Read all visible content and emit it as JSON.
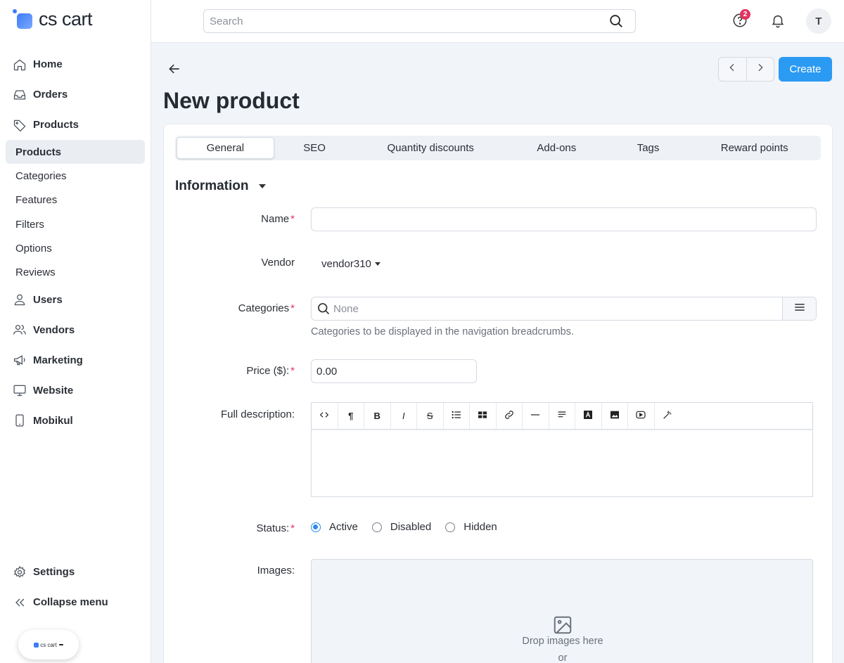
{
  "app": {
    "logo_text": "cs cart",
    "badge_text": "cs cart",
    "badge_tag": ""
  },
  "search": {
    "placeholder": "Search"
  },
  "header": {
    "notifications_count": "2",
    "avatar_initial": "T"
  },
  "sidebar": {
    "items": [
      {
        "label": "Home",
        "icon": "home-icon"
      },
      {
        "label": "Orders",
        "icon": "inbox-icon"
      },
      {
        "label": "Products",
        "icon": "tag-icon"
      }
    ],
    "sub_items": [
      "Products",
      "Categories",
      "Features",
      "Filters",
      "Options",
      "Reviews"
    ],
    "items_after": [
      {
        "label": "Users",
        "icon": "user-icon"
      },
      {
        "label": "Vendors",
        "icon": "users-icon"
      },
      {
        "label": "Marketing",
        "icon": "megaphone-icon"
      },
      {
        "label": "Website",
        "icon": "monitor-icon"
      },
      {
        "label": "Mobikul",
        "icon": "phone-icon"
      }
    ],
    "settings_label": "Settings",
    "collapse_label": "Collapse menu"
  },
  "page": {
    "title": "New product",
    "create_label": "Create"
  },
  "tabs": [
    "General",
    "SEO",
    "Quantity discounts",
    "Add-ons",
    "Tags",
    "Reward points"
  ],
  "section": {
    "title": "Information"
  },
  "form": {
    "name_label": "Name",
    "name_value": "",
    "vendor_label": "Vendor",
    "vendor_value": "vendor310",
    "categories_label": "Categories",
    "categories_placeholder": "None",
    "categories_hint": "Categories to be displayed in the navigation breadcrumbs.",
    "price_label": "Price ($):",
    "price_value": "0.00",
    "description_label": "Full description:",
    "status_label": "Status:",
    "status_options": [
      "Active",
      "Disabled",
      "Hidden"
    ],
    "status_selected": "Active",
    "images_label": "Images:",
    "dropzone_text": "Drop images here",
    "dropzone_or": "or"
  },
  "colors": {
    "accent": "#2b9af3",
    "required": "#e03560",
    "badge": "#e03560"
  }
}
